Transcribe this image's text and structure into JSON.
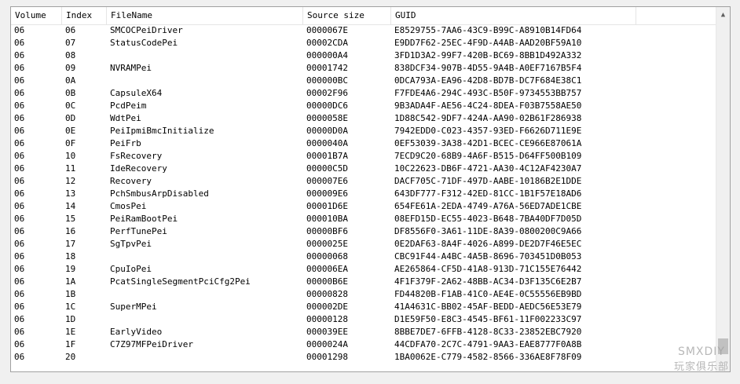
{
  "columns": [
    "Volume",
    "Index",
    "FileName",
    "Source size",
    "GUID"
  ],
  "rows": [
    [
      "06",
      "06",
      "SMCOCPeiDriver",
      "0000067E",
      "E8529755-7AA6-43C9-B99C-A8910B14FD64"
    ],
    [
      "06",
      "07",
      "StatusCodePei",
      "00002CDA",
      "E9DD7F62-25EC-4F9D-A4AB-AAD20BF59A10"
    ],
    [
      "06",
      "08",
      "",
      "000000A4",
      "3FD1D3A2-99F7-420B-BC69-8BB1D492A332"
    ],
    [
      "06",
      "09",
      "NVRAMPei",
      "00001742",
      "838DCF34-907B-4D55-9A4B-A0EF7167B5F4"
    ],
    [
      "06",
      "0A",
      "",
      "000000BC",
      "0DCA793A-EA96-42D8-BD7B-DC7F684E38C1"
    ],
    [
      "06",
      "0B",
      "CapsuleX64",
      "00002F96",
      "F7FDE4A6-294C-493C-B50F-9734553BB757"
    ],
    [
      "06",
      "0C",
      "PcdPeim",
      "00000DC6",
      "9B3ADA4F-AE56-4C24-8DEA-F03B7558AE50"
    ],
    [
      "06",
      "0D",
      "WdtPei",
      "0000058E",
      "1D88C542-9DF7-424A-AA90-02B61F286938"
    ],
    [
      "06",
      "0E",
      "PeiIpmiBmcInitialize",
      "00000D0A",
      "7942EDD0-C023-4357-93ED-F6626D711E9E"
    ],
    [
      "06",
      "0F",
      "PeiFrb",
      "0000040A",
      "0EF53039-3A38-42D1-BCEC-CE966E87061A"
    ],
    [
      "06",
      "10",
      "FsRecovery",
      "00001B7A",
      "7ECD9C20-68B9-4A6F-B515-D64FF500B109"
    ],
    [
      "06",
      "11",
      "IdeRecovery",
      "00000C5D",
      "10C22623-DB6F-4721-AA30-4C12AF4230A7"
    ],
    [
      "06",
      "12",
      "Recovery",
      "000007E6",
      "DACF705C-71DF-497D-AABE-10186B2E1DDE"
    ],
    [
      "06",
      "13",
      "PchSmbusArpDisabled",
      "000009E6",
      "643DF777-F312-42ED-81CC-1B1F57E18AD6"
    ],
    [
      "06",
      "14",
      "CmosPei",
      "00001D6E",
      "654FE61A-2EDA-4749-A76A-56ED7ADE1CBE"
    ],
    [
      "06",
      "15",
      "PeiRamBootPei",
      "000010BA",
      "08EFD15D-EC55-4023-B648-7BA40DF7D05D"
    ],
    [
      "06",
      "16",
      "PerfTunePei",
      "00000BF6",
      "DF8556F0-3A61-11DE-8A39-0800200C9A66"
    ],
    [
      "06",
      "17",
      "SgTpvPei",
      "0000025E",
      "0E2DAF63-8A4F-4026-A899-DE2D7F46E5EC"
    ],
    [
      "06",
      "18",
      "",
      "00000068",
      "CBC91F44-A4BC-4A5B-8696-703451D0B053"
    ],
    [
      "06",
      "19",
      "CpuIoPei",
      "000006EA",
      "AE265864-CF5D-41A8-913D-71C155E76442"
    ],
    [
      "06",
      "1A",
      "PcatSingleSegmentPciCfg2Pei",
      "00000B6E",
      "4F1F379F-2A62-48BB-AC34-D3F135C6E2B7"
    ],
    [
      "06",
      "1B",
      "",
      "00000828",
      "FD44820B-F1AB-41C0-AE4E-0C55556EB9BD"
    ],
    [
      "06",
      "1C",
      "SuperMPei",
      "000002DE",
      "41A4631C-BB02-45AF-BEDD-AEDC56E53E79"
    ],
    [
      "06",
      "1D",
      "",
      "00000128",
      "D1E59F50-E8C3-4545-BF61-11F002233C97"
    ],
    [
      "06",
      "1E",
      "EarlyVideo",
      "000039EE",
      "8BBE7DE7-6FFB-4128-8C33-23852EBC7920"
    ],
    [
      "06",
      "1F",
      "C7Z97MFPeiDriver",
      "0000024A",
      "44CDFA70-2C7C-4791-9AA3-EAE8777F0A8B"
    ],
    [
      "06",
      "20",
      "",
      "00001298",
      "1BA0062E-C779-4582-8566-336AE8F78F09"
    ]
  ],
  "watermark": {
    "line1": "SMXDIY",
    "line2": "玩家俱乐部"
  }
}
